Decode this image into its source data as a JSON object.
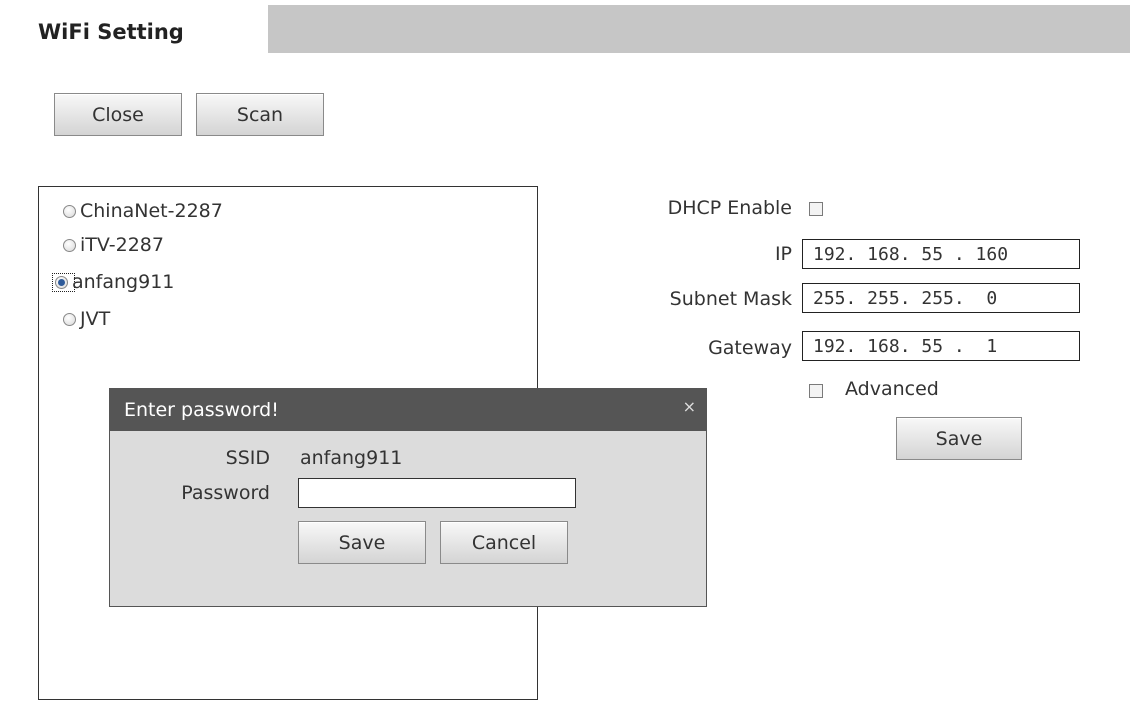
{
  "header": {
    "title": "WiFi Setting"
  },
  "toolbar": {
    "close_label": "Close",
    "scan_label": "Scan"
  },
  "networks": [
    {
      "ssid": "ChinaNet-2287",
      "selected": false
    },
    {
      "ssid": "iTV-2287",
      "selected": false
    },
    {
      "ssid": "anfang911",
      "selected": true
    },
    {
      "ssid": "JVT",
      "selected": false
    }
  ],
  "settings": {
    "dhcp_label": "DHCP Enable",
    "dhcp_checked": false,
    "ip_label": "IP",
    "ip_value": "192. 168. 55 . 160",
    "mask_label": "Subnet Mask",
    "mask_value": "255. 255. 255.  0",
    "gateway_label": "Gateway",
    "gateway_value": "192. 168. 55 .  1",
    "advanced_label": "Advanced",
    "advanced_checked": false,
    "save_label": "Save"
  },
  "dialog": {
    "title": "Enter password!",
    "close_glyph": "×",
    "ssid_label": "SSID",
    "ssid_value": "anfang911",
    "password_label": "Password",
    "password_value": "",
    "save_label": "Save",
    "cancel_label": "Cancel"
  }
}
